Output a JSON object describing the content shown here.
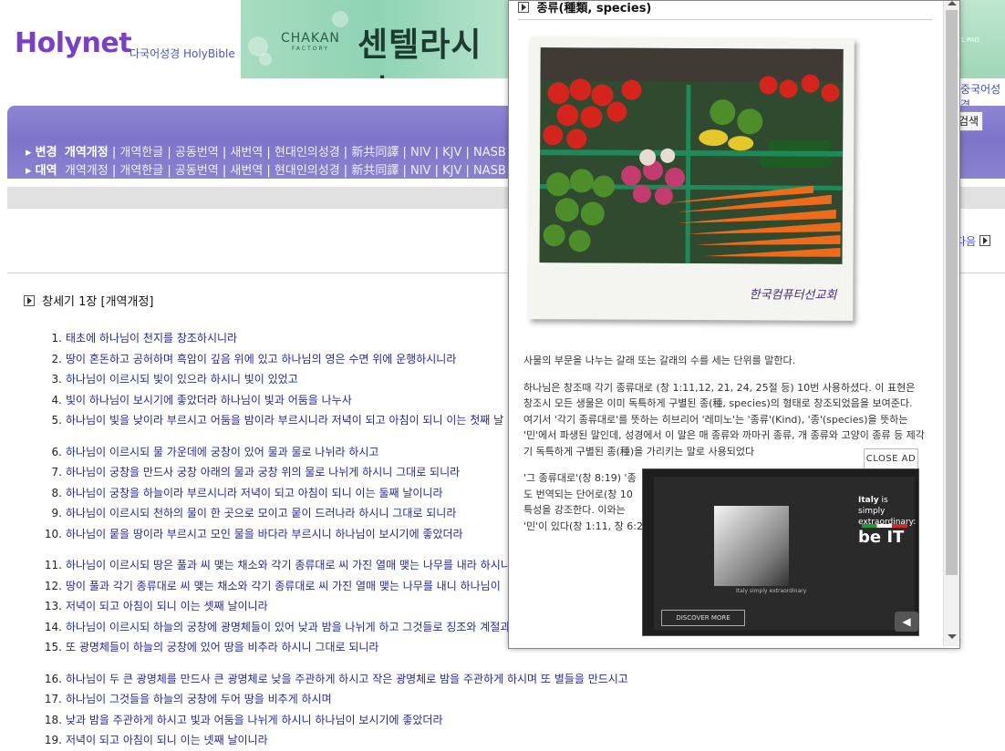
{
  "site": {
    "logo": "Holynet",
    "subtitle": "다국어성경 HolyBible"
  },
  "banner": {
    "brand": "CHAKAN",
    "brand_small": "FACTORY",
    "headline": "센텔라시키",
    "right_label": "L PAD",
    "right_lang": "중국어성경"
  },
  "nav": {
    "row1": {
      "lead": "변경",
      "items": [
        "개역개정",
        "개역한글",
        "공동번역",
        "새번역",
        "현대인의성경",
        "新共同譯",
        "NIV",
        "KJV",
        "NASB"
      ]
    },
    "row2": {
      "lead": "대역",
      "items": [
        "개역개정",
        "개역한글",
        "공동번역",
        "새번역",
        "현대인의성경",
        "新共同譯",
        "NIV",
        "KJV",
        "NASB"
      ]
    },
    "search_label": "검색",
    "next_label": "다음"
  },
  "chapter_title": "창세기 1장 [개역개정]",
  "verses": [
    {
      "n": "1.",
      "t": "태초에 하나님이 천지를 창조하시니라"
    },
    {
      "n": "2.",
      "t": "땅이 혼돈하고 공허하며 흑암이 깊음 위에 있고 하나님의 영은 수면 위에 운행하시니라"
    },
    {
      "n": "3.",
      "t": "하나님이 이르시되 빛이 있으라 하시니 빛이 있었고"
    },
    {
      "n": "4.",
      "t": "빛이 하나님이 보시기에 좋았더라 하나님이 빛과 어둠을 나누사"
    },
    {
      "n": "5.",
      "t": "하나님이 빛을 낮이라 부르시고 어둠을 밤이라 부르시니라 저녁이 되고 아침이 되니 이는 첫째 날"
    },
    {
      "n": "6.",
      "t": "하나님이 이르시되 물 가운데에 궁창이 있어 물과 물로 나뉘라 하시고"
    },
    {
      "n": "7.",
      "t": "하나님이 궁창을 만드사 궁창 아래의 물과 궁창 위의 물로 나뉘게 하시니 그대로 되니라"
    },
    {
      "n": "8.",
      "t": "하나님이 궁창을 하늘이라 부르시니라 저녁이 되고 아침이 되니 이는 둘째 날이니라"
    },
    {
      "n": "9.",
      "t": "하나님이 이르시되 천하의 물이 한 곳으로 모이고 뭍이 드러나라 하시니 그대로 되니라"
    },
    {
      "n": "10.",
      "t": "하나님이 뭍을 땅이라 부르시고 모인 물을 바다라 부르시니 하나님이 보시기에 좋았더라"
    },
    {
      "n": "11.",
      "t": "하나님이 이르시되 땅은 풀과 씨 맺는 채소와 각기 종류대로 씨 가진 열매 맺는 나무를 내라 하시니"
    },
    {
      "n": "12.",
      "t": "땅이 풀과 각기 종류대로 씨 맺는 채소와 각기 종류대로 씨 가진 열매 맺는 나무를 내니 하나님이"
    },
    {
      "n": "13.",
      "t": "저녁이 되고 아침이 되니 이는 셋째 날이니라"
    },
    {
      "n": "14.",
      "t": "하나님이 이르시되 하늘의 궁창에 광명체들이 있어 낮과 밤을 나뉘게 하고 그것들로 징조와 계절과"
    },
    {
      "n": "15.",
      "t": "또 광명체들이 하늘의 궁창에 있어 땅을 비추라 하시니 그대로 되니라"
    },
    {
      "n": "16.",
      "t": "하나님이 두 큰 광명체를 만드사 큰 광명체로 낮을 주관하게 하시고 작은 광명체로 밤을 주관하게 하시며 또 별들을 만드시고"
    },
    {
      "n": "17.",
      "t": "하나님이 그것들을 하늘의 궁창에 두어 땅을 비추게 하시며"
    },
    {
      "n": "18.",
      "t": "낮과 밤을 주관하게 하시고 빛과 어둠을 나뉘게 하시니 하나님이 보시기에 좋았더라"
    },
    {
      "n": "19.",
      "t": "저녁이 되고 아침이 되니 이는 넷째 날이니라"
    }
  ],
  "popup": {
    "title": "종류(種類, species)",
    "photo_signature": "한국컴퓨터선교회",
    "para1": "사물의 부문을 나누는 갈래 또는 갈래의 수를 세는 단위를 말한다.",
    "para2": "하나님은 창조때 각기 종류대로 (창 1:11,12, 21, 24, 25절 등) 10번 사용하셨다. 이 표현은 창조시 모든 생물은 이미 독특하게 구별된 종(種, species)의 형태로 창조되었음을 보여준다. 여기서 '각기 종류대로'를 뜻하는 히브리어 '레미노'는 '종류'(Kind), '종'(species)을 뜻하는 '민'에서 파생된 말인데, 성경에서 이 말은 매 종류와 까마귀 종류, 개 종류와 고양이 종류 등 제각기 독특하게 구별된 종(種)을 가리키는 말로 사용되었다",
    "para3_a": "'그 종류대로'(창 8:19) '종",
    "para3_b": "도 번역되는 단어로(창 10",
    "para3_c": "특성을 강조한다.  이와는",
    "para3_d": "'민'이 있다(창 1:11, 창 6:2"
  },
  "ad": {
    "close_label": "CLOSE AD",
    "tagline_bold": "Italy",
    "tagline_rest": " is simply extraordinary:",
    "brand": "be IT",
    "discover": "DISCOVER MORE",
    "caption": "Italy simply extraordinary"
  }
}
